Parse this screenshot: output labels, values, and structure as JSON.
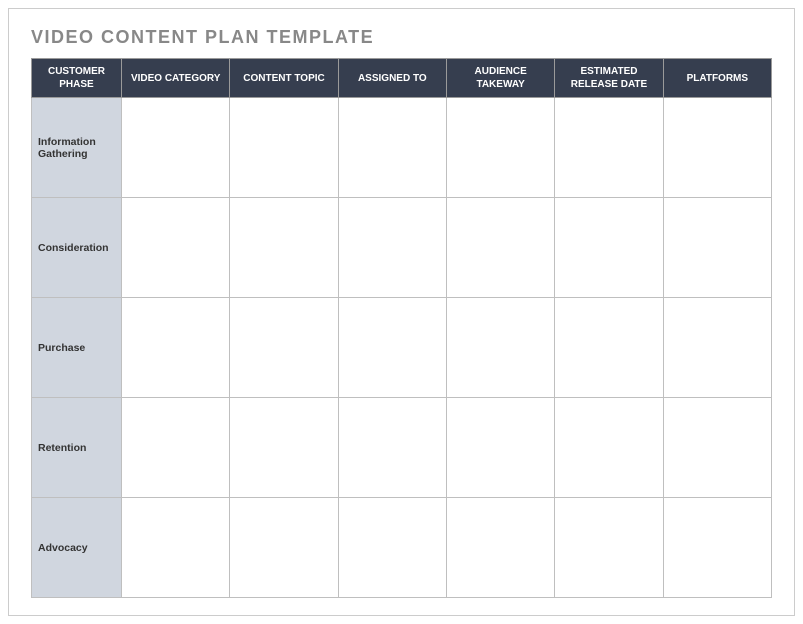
{
  "title": "VIDEO CONTENT PLAN TEMPLATE",
  "columns": [
    "CUSTOMER PHASE",
    "VIDEO CATEGORY",
    "CONTENT TOPIC",
    "ASSIGNED TO",
    "AUDIENCE TAKEWAY",
    "ESTIMATED RELEASE DATE",
    "PLATFORMS"
  ],
  "rows": [
    {
      "phase": "Information Gathering",
      "video_category": "",
      "content_topic": "",
      "assigned_to": "",
      "audience_takeaway": "",
      "estimated_release_date": "",
      "platforms": ""
    },
    {
      "phase": "Consideration",
      "video_category": "",
      "content_topic": "",
      "assigned_to": "",
      "audience_takeaway": "",
      "estimated_release_date": "",
      "platforms": ""
    },
    {
      "phase": "Purchase",
      "video_category": "",
      "content_topic": "",
      "assigned_to": "",
      "audience_takeaway": "",
      "estimated_release_date": "",
      "platforms": ""
    },
    {
      "phase": "Retention",
      "video_category": "",
      "content_topic": "",
      "assigned_to": "",
      "audience_takeaway": "",
      "estimated_release_date": "",
      "platforms": ""
    },
    {
      "phase": "Advocacy",
      "video_category": "",
      "content_topic": "",
      "assigned_to": "",
      "audience_takeaway": "",
      "estimated_release_date": "",
      "platforms": ""
    }
  ]
}
